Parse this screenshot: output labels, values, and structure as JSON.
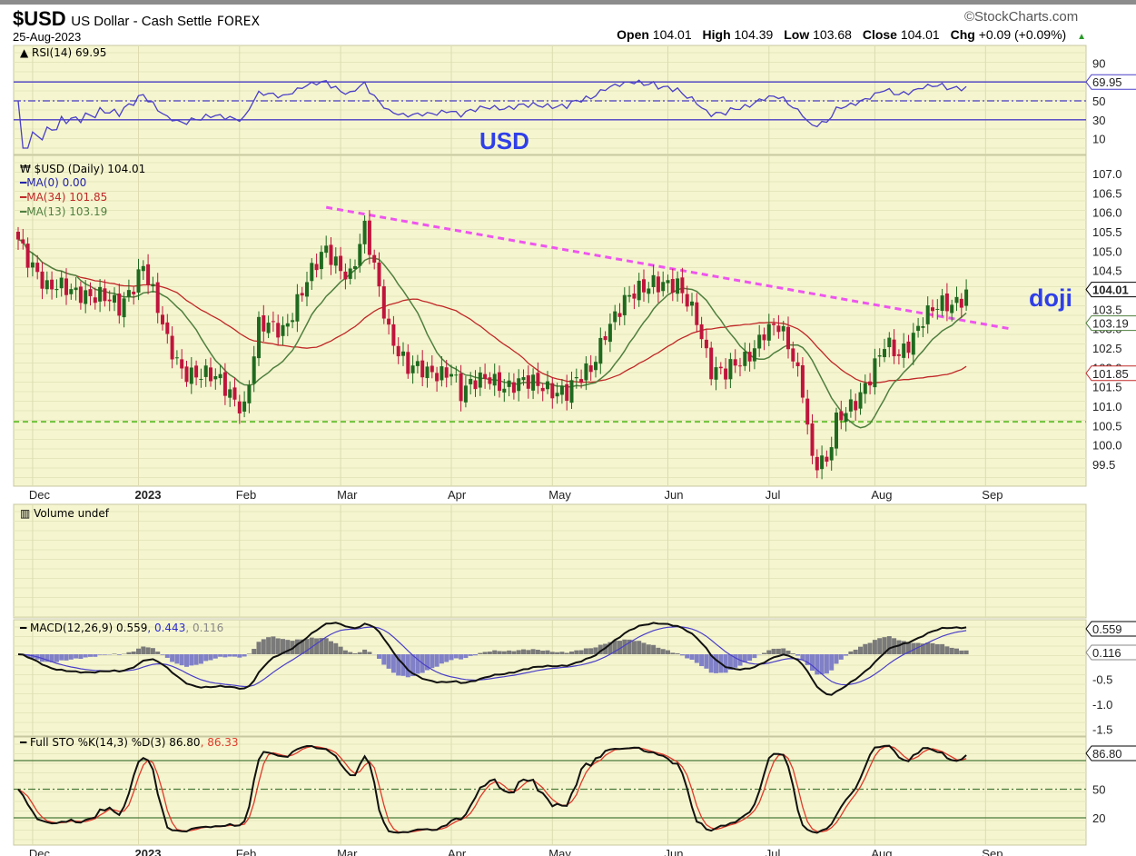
{
  "header": {
    "symbol": "$USD",
    "name": "US Dollar - Cash Settle",
    "exchange": "FOREX",
    "date": "25-Aug-2023",
    "brand": "©StockCharts.com",
    "ohlc": [
      {
        "k": "Open",
        "v": "104.01"
      },
      {
        "k": "High",
        "v": "104.39"
      },
      {
        "k": "Low",
        "v": "103.68"
      },
      {
        "k": "Close",
        "v": "104.01"
      },
      {
        "k": "Chg",
        "v": "+0.09 (+0.09%)"
      }
    ]
  },
  "annotations": {
    "usd": "USD",
    "doji": "doji"
  },
  "colors": {
    "bg": "#f5f5cf",
    "up": "#1f6a1f",
    "down": "#c0143c",
    "ma34": "#c02828",
    "ma13": "#4f7f3f",
    "trend": "#ee55ee",
    "support": "#6ec23a",
    "rsi": "#4a3fc8"
  },
  "chart_data": [
    {
      "type": "line",
      "title": "RSI(14) 69.95",
      "legend": "RSI(14) 69.95",
      "ylim": [
        0,
        100
      ],
      "ticks": [
        "90",
        "70",
        "50",
        "30",
        "10"
      ],
      "bands": [
        30,
        50,
        70
      ],
      "last_label": "69.95"
    },
    {
      "type": "candlestick",
      "title": "$USD (Daily) 104.01",
      "legend": [
        "$USD (Daily) 104.01",
        "MA(0) 0.00",
        "MA(34) 101.85",
        "MA(13) 103.19"
      ],
      "ylim": [
        99.2,
        107.3
      ],
      "ticks": [
        "107.0",
        "106.5",
        "106.0",
        "105.5",
        "105.0",
        "104.5",
        "104.0",
        "103.5",
        "103.0",
        "102.5",
        "102.0",
        "101.5",
        "101.0",
        "100.5",
        "100.0",
        "99.5"
      ],
      "x_months": [
        {
          "label": "Dec",
          "day": 3
        },
        {
          "label": "2023",
          "day": 25
        },
        {
          "label": "Feb",
          "day": 46
        },
        {
          "label": "Mar",
          "day": 67
        },
        {
          "label": "Apr",
          "day": 90
        },
        {
          "label": "May",
          "day": 111
        },
        {
          "label": "Jun",
          "day": 135
        },
        {
          "label": "Jul",
          "day": 156
        },
        {
          "label": "Aug",
          "day": 178
        },
        {
          "label": "Sep",
          "day": 201
        }
      ],
      "close_keypoints": [
        [
          0,
          105.3
        ],
        [
          4,
          104.5
        ],
        [
          6,
          104.0
        ],
        [
          13,
          104.0
        ],
        [
          17,
          103.8
        ],
        [
          21,
          103.5
        ],
        [
          26,
          104.7
        ],
        [
          31,
          102.6
        ],
        [
          34,
          102.0
        ],
        [
          42,
          101.6
        ],
        [
          47,
          101.0
        ],
        [
          50,
          103.0
        ],
        [
          55,
          103.0
        ],
        [
          59,
          104.0
        ],
        [
          64,
          105.0
        ],
        [
          69,
          104.4
        ],
        [
          72,
          105.5
        ],
        [
          74,
          104.5
        ],
        [
          77,
          103.0
        ],
        [
          81,
          102.0
        ],
        [
          85,
          101.8
        ],
        [
          90,
          102.0
        ],
        [
          92,
          101.3
        ],
        [
          98,
          101.8
        ],
        [
          102,
          101.5
        ],
        [
          109,
          101.6
        ],
        [
          114,
          101.3
        ],
        [
          119,
          102.0
        ],
        [
          122,
          103.0
        ],
        [
          126,
          103.6
        ],
        [
          129,
          104.0
        ],
        [
          132,
          104.3
        ],
        [
          137,
          104.0
        ],
        [
          141,
          103.3
        ],
        [
          144,
          102.0
        ],
        [
          147,
          101.8
        ],
        [
          151,
          102.2
        ],
        [
          155,
          103.0
        ],
        [
          158,
          103.0
        ],
        [
          161,
          102.2
        ],
        [
          163,
          101.5
        ],
        [
          165,
          99.7
        ],
        [
          168,
          99.5
        ],
        [
          170,
          100.5
        ],
        [
          174,
          101.2
        ],
        [
          177,
          101.8
        ],
        [
          180,
          102.5
        ],
        [
          183,
          102.3
        ],
        [
          185,
          102.7
        ],
        [
          188,
          103.3
        ],
        [
          191,
          103.5
        ],
        [
          194,
          103.6
        ],
        [
          197,
          104.01
        ]
      ],
      "trendline": [
        [
          64,
          106.13
        ],
        [
          206,
          103.0
        ]
      ],
      "support": 100.6,
      "tags": [
        {
          "v": "104.01",
          "p": 104.01
        },
        {
          "v": "103.19",
          "p": 103.19
        },
        {
          "v": "101.85",
          "p": 101.85
        }
      ]
    },
    {
      "type": "bar",
      "title": "Volume undef",
      "legend": "Volume undef"
    },
    {
      "type": "line",
      "title": "MACD(12,26,9)",
      "legend": [
        "MACD(12,26,9) 0.559",
        ", 0.443",
        ", 0.116"
      ],
      "ylim": [
        -1.7,
        0.75
      ],
      "ticks": [
        "-0.5",
        "-1.0",
        "-1.5"
      ],
      "tags": [
        "0.559",
        "0.116"
      ]
    },
    {
      "type": "line",
      "title": "Full STO %K(14,3) %D(3)",
      "legend": [
        "Full STO %K(14,3) %D(3) 86.80",
        ", 86.33"
      ],
      "ylim": [
        0,
        100
      ],
      "ticks": [
        "50",
        "20"
      ],
      "bands": [
        20,
        50,
        80
      ],
      "tag": "86.80"
    }
  ]
}
